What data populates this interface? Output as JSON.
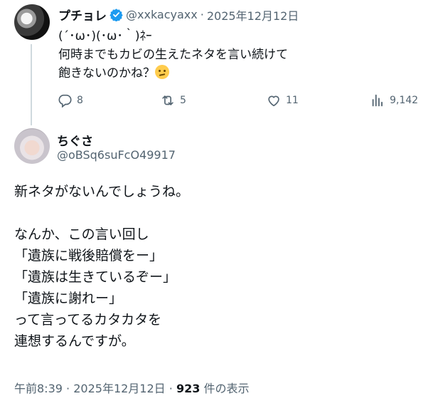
{
  "parent_tweet": {
    "display_name": "プチョレ",
    "handle": "@xxkacyaxx",
    "separator": "·",
    "date": "2025年12月12日",
    "text": "(´･ω･)(･ω･｀)ﾈｰ\n何時までもカビの生えたネタを言い続けて\n飽きないのかね？",
    "emoji_icon": "thinking-face-emoji",
    "replies": "8",
    "reposts": "5",
    "likes": "11",
    "views": "9,142"
  },
  "main_tweet": {
    "display_name": "ちぐさ",
    "handle": "@oBSq6suFcO49917",
    "text": "新ネタがないんでしょうね。\n\nなんか、この言い回し\n「遺族に戦後賠償をー」\n「遺族は生きているぞー」\n「遺族に謝れー」\nって言ってるカタカタを\n連想するんですが。",
    "time": "午前8:39",
    "separator": "·",
    "date": "2025年12月12日",
    "views_count": "923",
    "views_label": "件の表示"
  },
  "colors": {
    "text": "#0f1419",
    "secondary": "#536471",
    "verified": "#1d9bf0",
    "thread_line": "#cfd9de"
  }
}
